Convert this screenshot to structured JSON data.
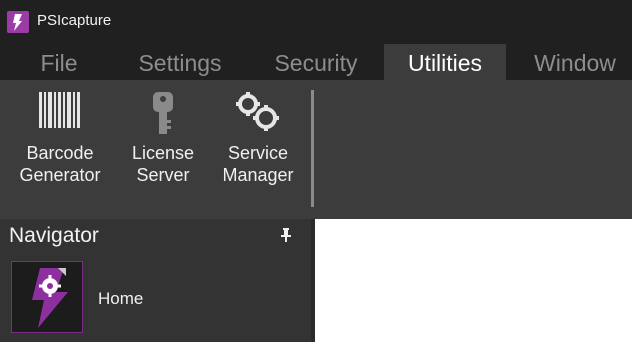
{
  "window": {
    "title": "PSIcapture",
    "accent": "#9b3ba6"
  },
  "menu": {
    "tabs": [
      {
        "label": "File"
      },
      {
        "label": "Settings"
      },
      {
        "label": "Security"
      },
      {
        "label": "Utilities",
        "active": true
      },
      {
        "label": "Window"
      }
    ]
  },
  "ribbon": {
    "buttons": [
      {
        "label_line1": "Barcode",
        "label_line2": "Generator",
        "icon": "barcode-icon"
      },
      {
        "label_line1": "License",
        "label_line2": "Server",
        "icon": "key-icon"
      },
      {
        "label_line1": "Service",
        "label_line2": "Manager",
        "icon": "gears-icon"
      }
    ]
  },
  "navigator": {
    "title": "Navigator",
    "pin_icon": "pin-icon",
    "items": [
      {
        "label": "Home",
        "icon": "home-gear-icon"
      }
    ]
  }
}
